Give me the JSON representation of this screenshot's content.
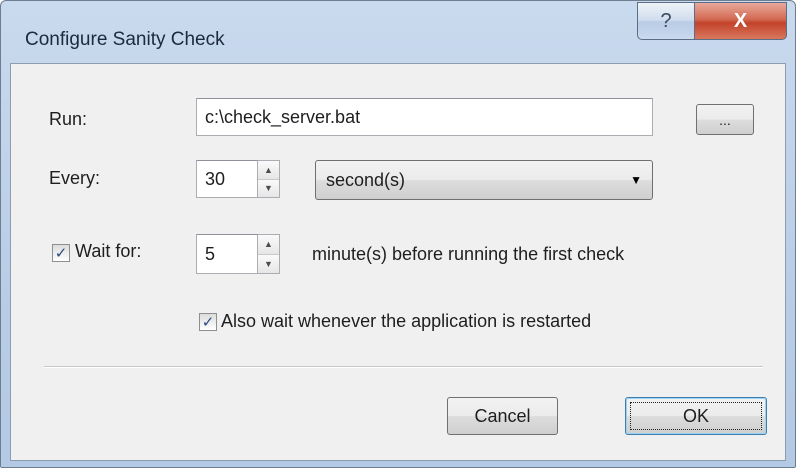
{
  "window": {
    "title": "Configure Sanity Check",
    "help_glyph": "?",
    "close_glyph": "X"
  },
  "run": {
    "label": "Run:",
    "value": "c:\\check_server.bat",
    "browse_label": "..."
  },
  "every": {
    "label": "Every:",
    "value": "30",
    "unit": "second(s)"
  },
  "wait": {
    "label": "Wait for:",
    "checked": true,
    "value": "5",
    "suffix": "minute(s) before running the first check"
  },
  "restart": {
    "label": "Also wait whenever the application is restarted",
    "checked": true
  },
  "buttons": {
    "cancel": "Cancel",
    "ok": "OK"
  },
  "glyphs": {
    "check": "✓",
    "spin_up": "▲",
    "spin_down": "▼",
    "dropdown": "▼"
  }
}
